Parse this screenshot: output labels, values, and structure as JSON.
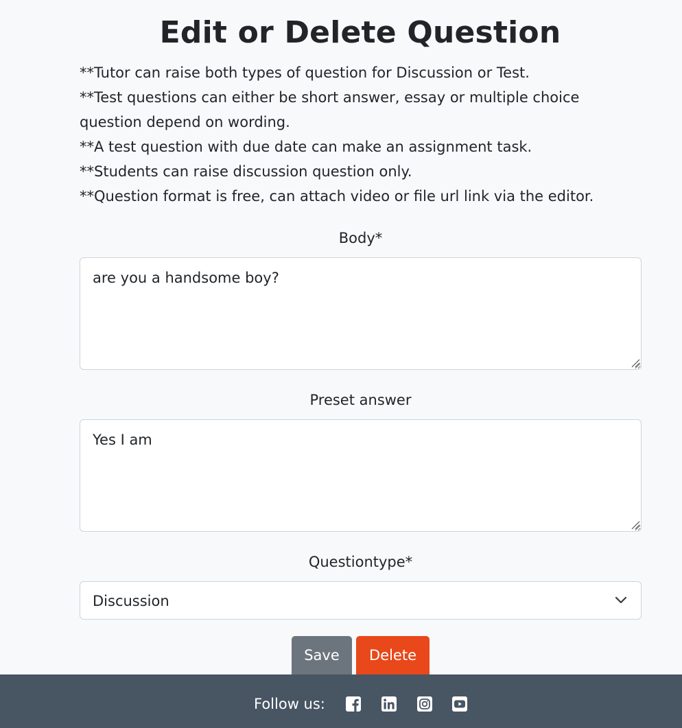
{
  "page": {
    "title": "Edit or Delete Question"
  },
  "notes": [
    "**Tutor can raise both types of question for Discussion or Test.",
    "**Test questions can either be short answer, essay or multiple choice",
    "question depend on wording.",
    "**A test question with due date can make an assignment task.",
    "**Students can raise discussion question only.",
    "**Question format is free, can attach video or file url link via the editor."
  ],
  "form": {
    "body": {
      "label": "Body*",
      "value": "are you a handsome boy?"
    },
    "preset_answer": {
      "label": "Preset answer",
      "value": "Yes I am"
    },
    "question_type": {
      "label": "Questiontype*",
      "selected": "Discussion"
    },
    "save_label": "Save",
    "delete_label": "Delete"
  },
  "footer": {
    "follow_label": "Follow us:",
    "social_icons": [
      "facebook-icon",
      "linkedin-icon",
      "instagram-icon",
      "youtube-icon"
    ]
  },
  "colors": {
    "background": "#f8f9fa",
    "save_button": "#6c757d",
    "delete_button": "#e8481a",
    "footer": "#485563"
  }
}
